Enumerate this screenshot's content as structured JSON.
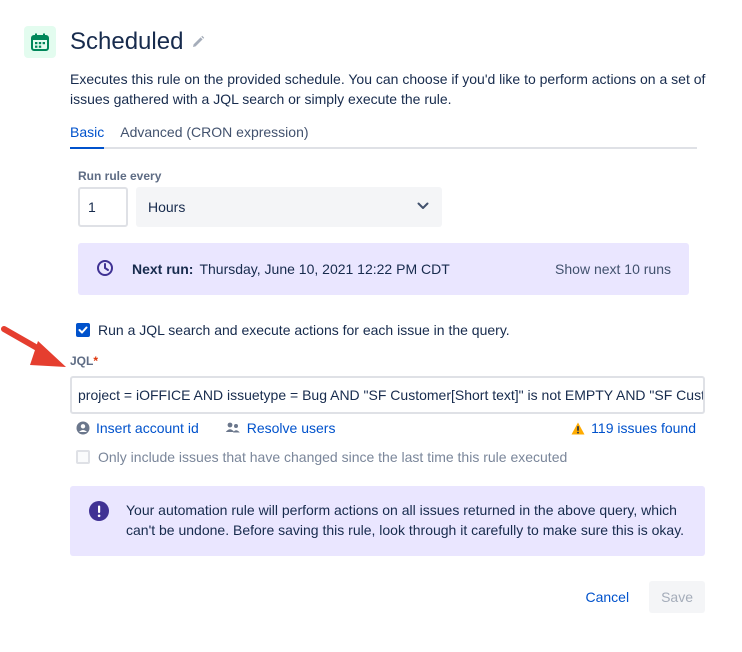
{
  "header": {
    "title": "Scheduled",
    "icon": "calendar-icon",
    "description": "Executes this rule on the provided schedule. You can choose if you'd like to perform actions on a set of issues gathered with a JQL search or simply execute the rule."
  },
  "tabs": [
    {
      "label": "Basic",
      "active": true
    },
    {
      "label": "Advanced (CRON expression)",
      "active": false
    }
  ],
  "schedule": {
    "run_every_label": "Run rule every",
    "interval_value": "1",
    "unit_selected": "Hours"
  },
  "next_run": {
    "label": "Next run:",
    "value": "Thursday, June 10, 2021 12:22 PM CDT",
    "show_more": "Show next 10 runs"
  },
  "jql_toggle": {
    "label": "Run a JQL search and execute actions for each issue in the query.",
    "checked": true
  },
  "jql": {
    "label": "JQL",
    "required_mark": "*",
    "value": "project = iOFFICE AND issuetype = Bug AND \"SF Customer[Short text]\" is not EMPTY AND \"SF Custo"
  },
  "links": {
    "insert_account": "Insert account id",
    "resolve_users": "Resolve users",
    "issues_found": "119 issues found"
  },
  "only_changed": {
    "label": "Only include issues that have changed since the last time this rule executed",
    "checked": false
  },
  "warning": {
    "text": "Your automation rule will perform actions on all issues returned in the above query, which can't be undone. Before saving this rule, look through it carefully to make sure this is okay."
  },
  "footer": {
    "cancel": "Cancel",
    "save": "Save"
  },
  "colors": {
    "primary": "#0052cc",
    "panel": "#eae6ff",
    "icon_bg": "#e3fcef",
    "icon_fg": "#00875a",
    "arrow": "#e53e2f",
    "warning_amber": "#ffab00",
    "purple": "#403294"
  }
}
